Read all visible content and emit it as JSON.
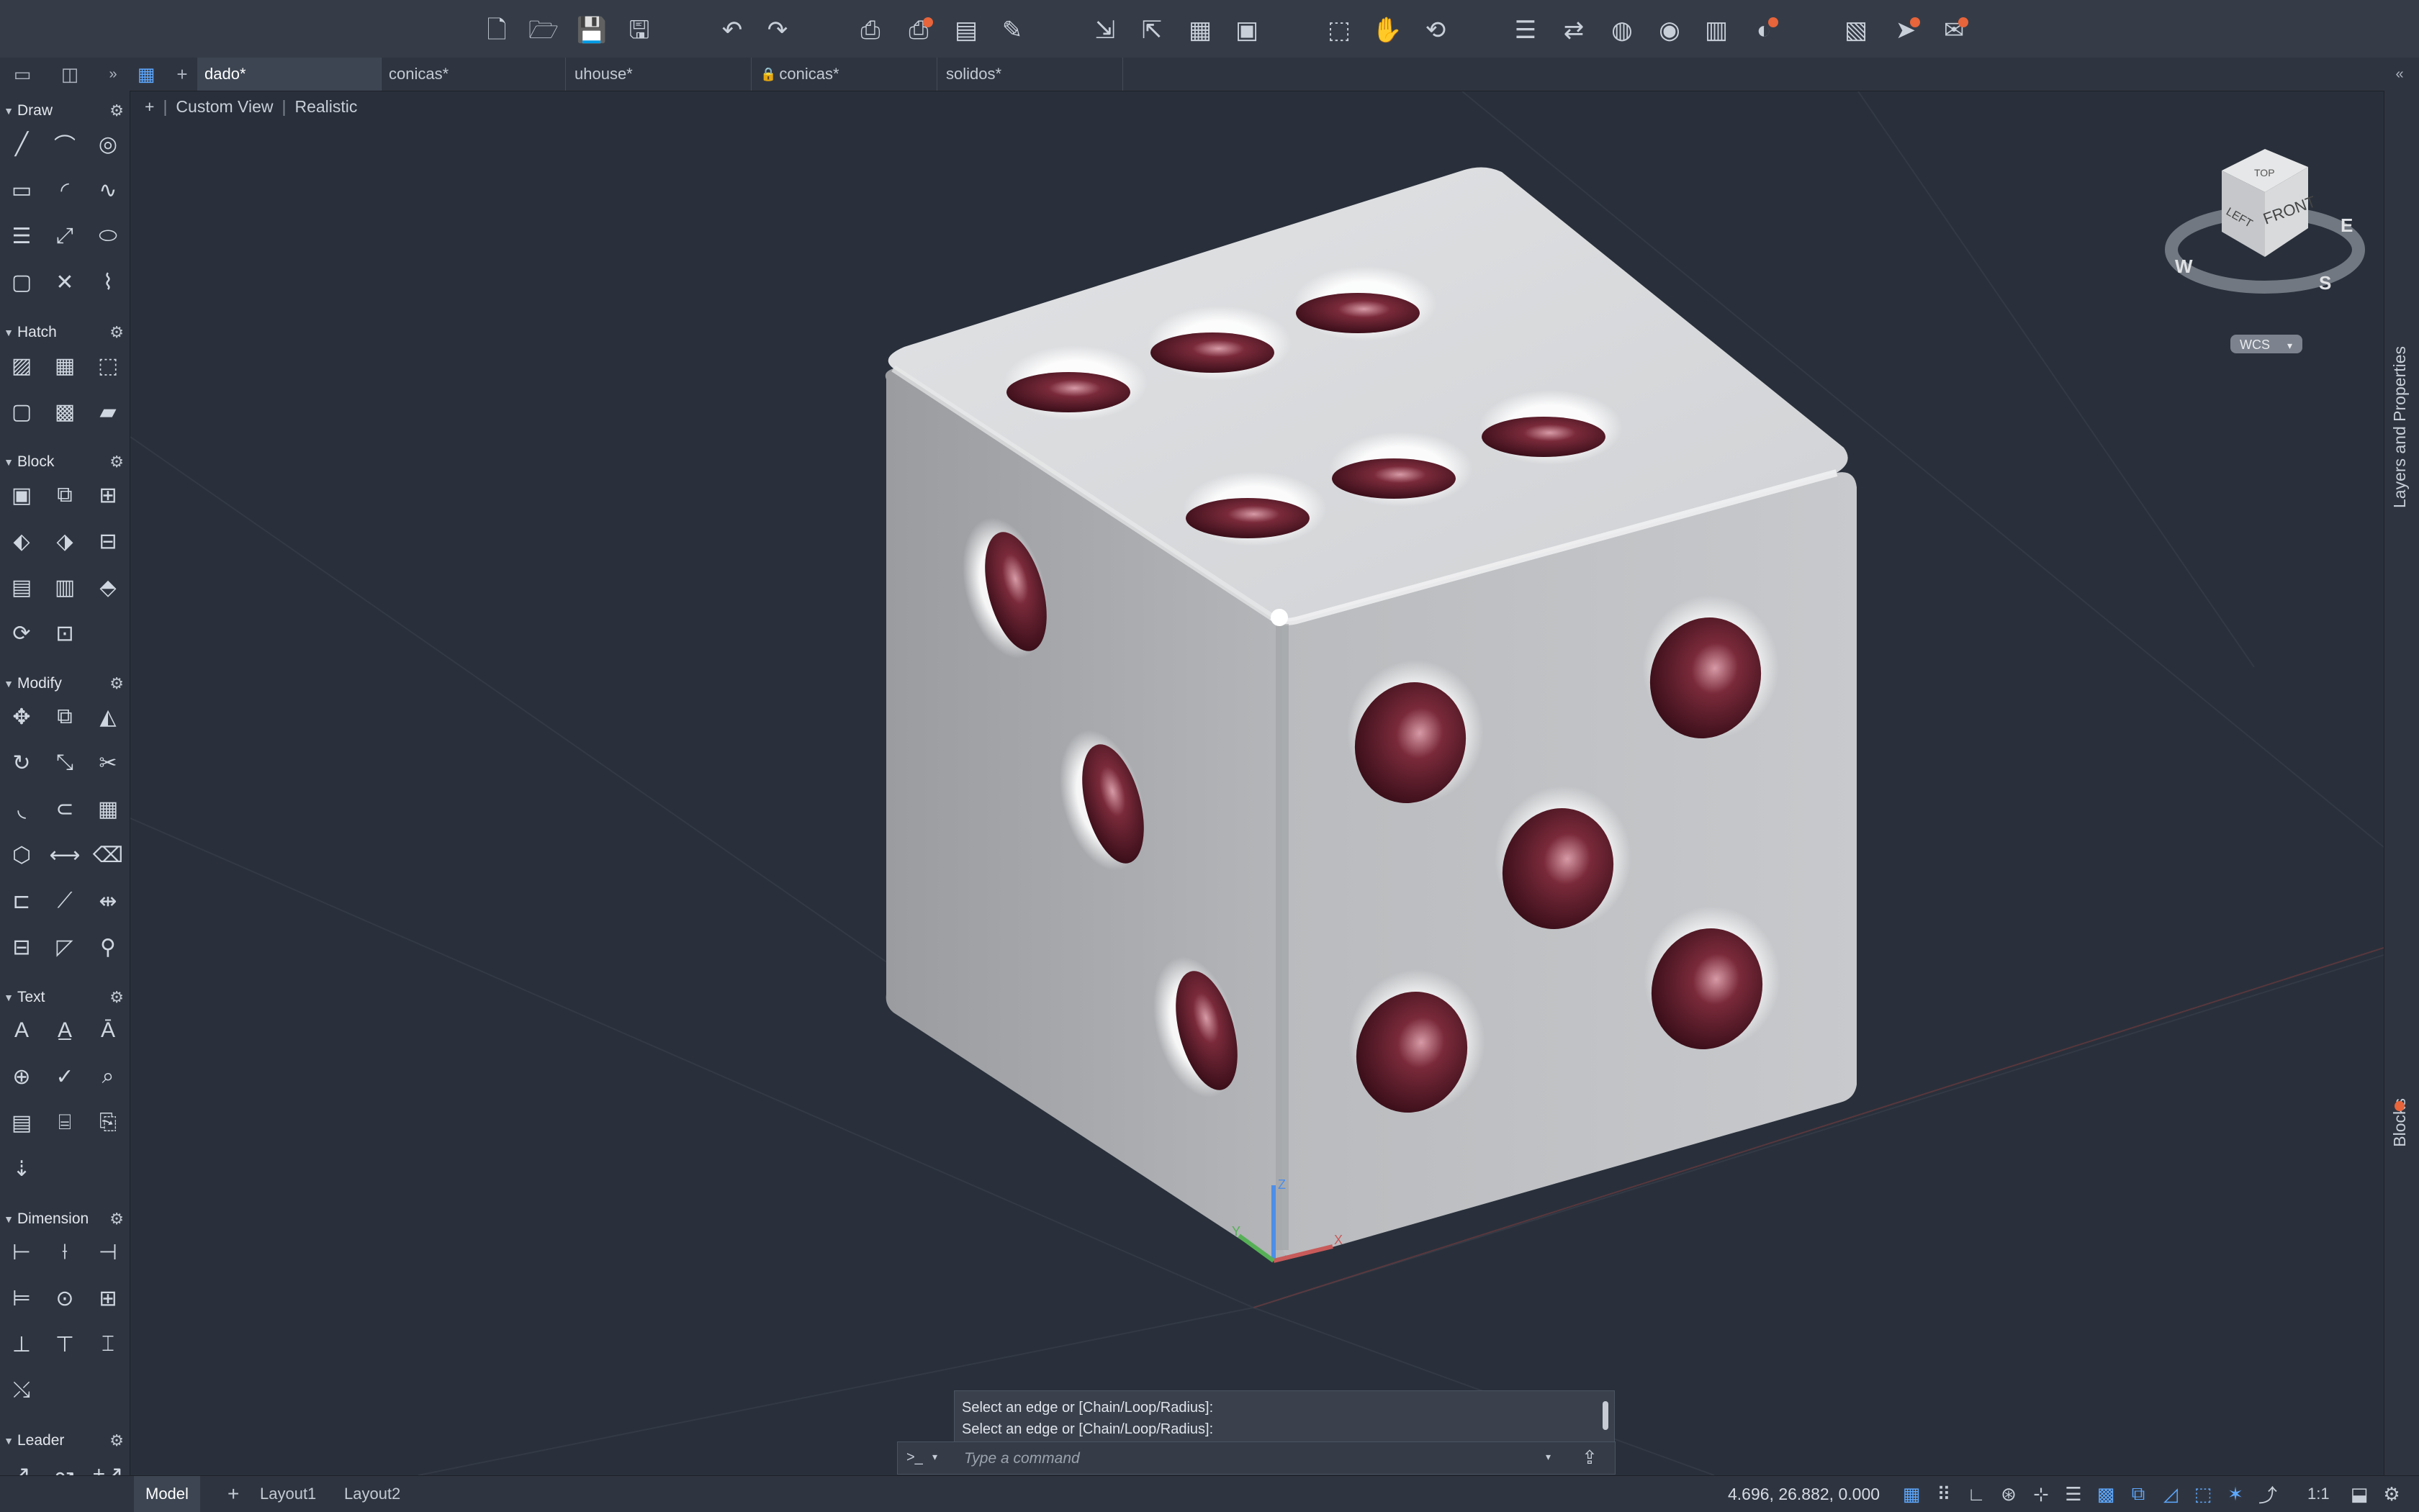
{
  "toolbar": {
    "buttons": [
      {
        "name": "new-file-icon",
        "glyph": "🗋"
      },
      {
        "name": "open-file-icon",
        "glyph": "🗁"
      },
      {
        "name": "save-icon",
        "glyph": "💾"
      },
      {
        "name": "save-as-icon",
        "glyph": "🖫"
      },
      {
        "name": "undo-icon",
        "glyph": "↶"
      },
      {
        "name": "redo-icon",
        "glyph": "↷"
      },
      {
        "name": "print-icon",
        "glyph": "⎙"
      },
      {
        "name": "batch-plot-icon",
        "glyph": "⎙"
      },
      {
        "name": "page-setup-icon",
        "glyph": "▤"
      },
      {
        "name": "publish-icon",
        "glyph": "✎"
      },
      {
        "name": "import-icon",
        "glyph": "⇲"
      },
      {
        "name": "export-icon",
        "glyph": "⇱"
      },
      {
        "name": "etransmit-icon",
        "glyph": "▦"
      },
      {
        "name": "share-view-icon",
        "glyph": "▣"
      },
      {
        "name": "zoom-window-icon",
        "glyph": "⬚"
      },
      {
        "name": "pan-hand-icon",
        "glyph": "✋"
      },
      {
        "name": "orbit-icon",
        "glyph": "⟲"
      },
      {
        "name": "properties-icon",
        "glyph": "☰"
      },
      {
        "name": "match-properties-icon",
        "glyph": "⇄"
      },
      {
        "name": "layer-manager-icon",
        "glyph": "◍"
      },
      {
        "name": "layer-states-icon",
        "glyph": "◉"
      },
      {
        "name": "xref-icon",
        "glyph": "▥"
      },
      {
        "name": "render-icon",
        "glyph": "◐"
      },
      {
        "name": "layout-icon",
        "glyph": "▧"
      },
      {
        "name": "send-icon",
        "glyph": "➤"
      },
      {
        "name": "mail-icon",
        "glyph": "✉"
      }
    ]
  },
  "tabs": [
    {
      "label": "dado*",
      "active": true,
      "locked": false
    },
    {
      "label": "conicas*",
      "active": false,
      "locked": false
    },
    {
      "label": "uhouse*",
      "active": false,
      "locked": false
    },
    {
      "label": "conicas*",
      "active": false,
      "locked": true
    },
    {
      "label": "solidos*",
      "active": false,
      "locked": false
    }
  ],
  "view": {
    "plus": "+",
    "view_name": "Custom View",
    "visual_style": "Realistic"
  },
  "viewcube": {
    "top": "TOP",
    "front": "FRONT",
    "left": "LEFT",
    "compass_w": "W",
    "compass_s": "S",
    "compass_e": "E",
    "ucs": "WCS"
  },
  "palette": [
    {
      "title": "Draw",
      "icons": [
        "line-icon",
        "polyline-icon",
        "circle-icon",
        "rectangle-icon",
        "arc-icon",
        "spline-icon",
        "multiline-icon",
        "xline-icon",
        "ellipse-icon",
        "region-icon",
        "trim-line-icon",
        "revcloud-icon"
      ]
    },
    {
      "title": "Hatch",
      "icons": [
        "hatch-icon",
        "gradient-icon",
        "boundary-icon",
        "region-icon",
        "wipeout-icon",
        "image-icon"
      ]
    },
    {
      "title": "Block",
      "icons": [
        "create-block-icon",
        "insert-block-icon",
        "block-editor-icon",
        "attribute-icon",
        "define-attribute-icon",
        "edit-attribute-icon",
        "block-palette-icon",
        "wblock-icon",
        "base-point-icon",
        "attribute-sync-icon",
        "block-library-icon"
      ]
    },
    {
      "title": "Modify",
      "icons": [
        "move-icon",
        "copy-icon",
        "mirror-icon",
        "rotate-icon",
        "scale-icon",
        "trim-icon",
        "fillet-icon",
        "offset-icon",
        "array-icon",
        "explode-icon",
        "stretch-icon",
        "erase-icon",
        "lengthen-icon",
        "break-icon",
        "join-icon",
        "align-icon",
        "chamfer-icon",
        "brush-icon"
      ]
    },
    {
      "title": "Text",
      "icons": [
        "multiline-text-icon",
        "single-line-text-icon",
        "text-style-icon",
        "find-text-icon",
        "spell-check-icon",
        "find-replace-icon",
        "text-table-icon",
        "text-field-icon",
        "pdf-text-icon",
        "pdf-import-icon"
      ]
    },
    {
      "title": "Dimension",
      "icons": [
        "linear-dim-icon",
        "aligned-dim-icon",
        "continue-dim-icon",
        "baseline-dim-icon",
        "radius-dim-icon",
        "ordinate-dim-icon",
        "dim-break-icon",
        "dim-space-icon",
        "dim-style-icon",
        "dim-update-icon"
      ]
    },
    {
      "title": "Leader",
      "icons": [
        "leader-icon",
        "multileader-icon",
        "add-leader-icon",
        "remove-leader-icon",
        "align-leader-icon"
      ]
    }
  ],
  "right_panel": {
    "layers_label": "Layers and Properties",
    "blocks_label": "Blocks"
  },
  "command": {
    "history": [
      "Select an edge or [Chain/Loop/Radius]:",
      "Select an edge or [Chain/Loop/Radius]:"
    ],
    "prompt": ">_",
    "placeholder": "Type a command"
  },
  "status": {
    "layout_tabs": [
      {
        "label": "Model",
        "active": true
      },
      {
        "label": "Layout1",
        "active": false
      },
      {
        "label": "Layout2",
        "active": false
      }
    ],
    "add_layout": "+",
    "coords": "4.696, 26.882, 0.000",
    "scale": "1:1"
  },
  "ucs_icon": {
    "z": "Z",
    "y": "Y",
    "x": "X"
  }
}
